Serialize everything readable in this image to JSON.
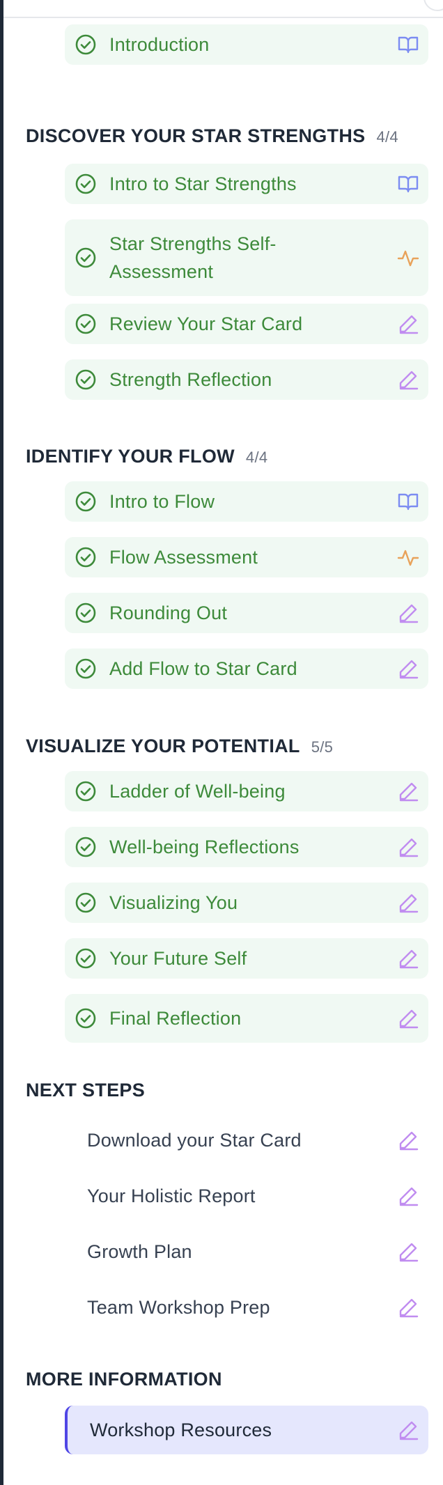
{
  "colors": {
    "done_green": "#3d8a3a",
    "book_blue": "#7c8cf2",
    "activity_orange": "#e8a25a",
    "pencil_purple": "#c08cf0",
    "active_bg": "#e5e7fd",
    "active_border": "#4f46e5"
  },
  "intro": {
    "label": "Introduction",
    "icon": "book-icon"
  },
  "sections": [
    {
      "title": "DISCOVER YOUR STAR STRENGTHS",
      "count": "4/4",
      "items": [
        {
          "label": "Intro to Star Strengths",
          "icon": "book-icon"
        },
        {
          "label": "Star Strengths Self-Assessment",
          "icon": "activity-icon"
        },
        {
          "label": "Review Your Star Card",
          "icon": "pencil-icon"
        },
        {
          "label": "Strength Reflection",
          "icon": "pencil-icon"
        }
      ]
    },
    {
      "title": "IDENTIFY YOUR FLOW",
      "count": "4/4",
      "items": [
        {
          "label": "Intro to Flow",
          "icon": "book-icon"
        },
        {
          "label": "Flow Assessment",
          "icon": "activity-icon"
        },
        {
          "label": "Rounding Out",
          "icon": "pencil-icon"
        },
        {
          "label": "Add Flow to Star Card",
          "icon": "pencil-icon"
        }
      ]
    },
    {
      "title": "VISUALIZE YOUR POTENTIAL",
      "count": "5/5",
      "items": [
        {
          "label": "Ladder of Well-being",
          "icon": "pencil-icon"
        },
        {
          "label": "Well-being Reflections",
          "icon": "pencil-icon"
        },
        {
          "label": "Visualizing You",
          "icon": "pencil-icon"
        },
        {
          "label": "Your Future Self",
          "icon": "pencil-icon"
        },
        {
          "label": "Final Reflection",
          "icon": "pencil-icon"
        }
      ]
    },
    {
      "title": "NEXT STEPS",
      "items": [
        {
          "label": "Download your Star Card",
          "icon": "pencil-icon"
        },
        {
          "label": "Your Holistic Report",
          "icon": "pencil-icon"
        },
        {
          "label": "Growth Plan",
          "icon": "pencil-icon"
        },
        {
          "label": "Team Workshop Prep",
          "icon": "pencil-icon"
        }
      ]
    },
    {
      "title": "MORE INFORMATION",
      "items": [
        {
          "label": "Workshop Resources",
          "icon": "pencil-icon"
        }
      ]
    }
  ]
}
